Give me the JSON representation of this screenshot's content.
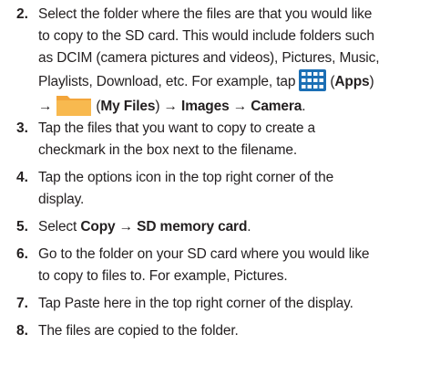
{
  "steps": [
    {
      "number": "2.",
      "lines": [
        "Select the folder where the files are that you would like",
        "to copy to the SD card. This would include folders such",
        "as DCIM (camera pictures and videos), Pictures, Music,"
      ],
      "line4_pre": "Playlists, Download, etc. For example, tap",
      "line4_bold": "Apps",
      "line5_arrow1": "→",
      "line5_bold1": "My Files",
      "line5_arrow2": "→",
      "line5_bold2": "Images",
      "line5_arrow3": "→",
      "line5_bold3": "Camera"
    },
    {
      "number": "3.",
      "lines": [
        "Tap the files that you want to copy to create a",
        "checkmark in the box next to the filename."
      ]
    },
    {
      "number": "4.",
      "lines": [
        "Tap the options icon in the top right corner of the",
        "display."
      ]
    },
    {
      "number": "5.",
      "pre": "Select",
      "bold": "Copy → SD memory card",
      "post": "."
    },
    {
      "number": "6.",
      "lines": [
        "Go to the folder on your SD card where you would like",
        "to copy to files to. For example, Pictures."
      ]
    },
    {
      "number": "7.",
      "lines": [
        "Tap Paste here in the top right corner of the display."
      ]
    },
    {
      "number": "8.",
      "lines": [
        "The files are copied to the folder."
      ]
    }
  ],
  "icons": {
    "apps": "apps-grid-icon",
    "my_files": "folder-icon",
    "apps_color": "#1b6fb5",
    "folder_color": "#f3a53a"
  }
}
